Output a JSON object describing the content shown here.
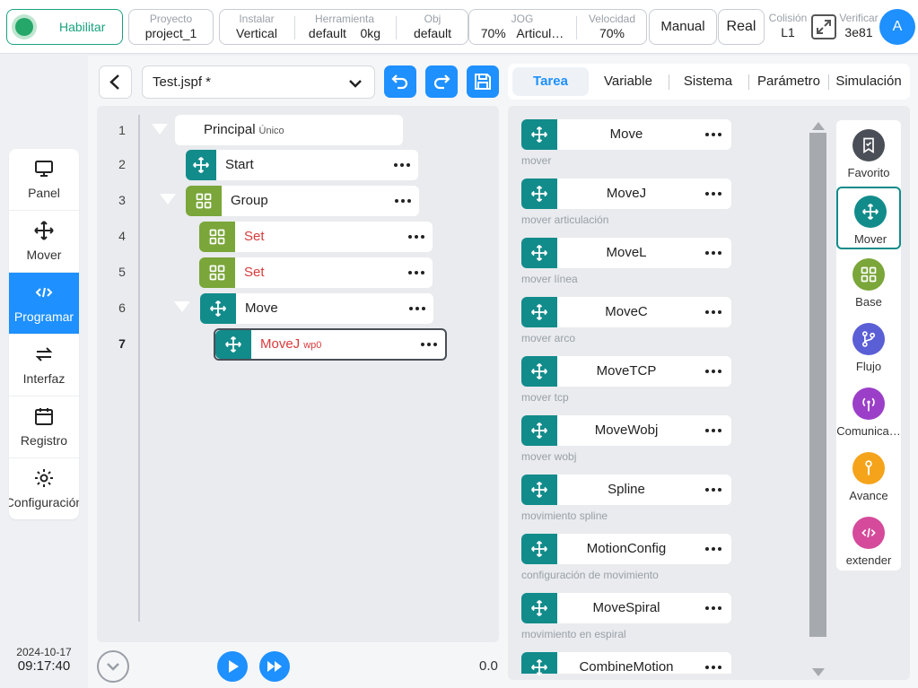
{
  "topbar": {
    "enable_label": "Habilitar",
    "project": {
      "label": "Proyecto",
      "value": "project_1"
    },
    "install": {
      "label": "Instalar",
      "value": "Vertical"
    },
    "tool": {
      "label": "Herramienta",
      "value": "default",
      "payload": "0kg"
    },
    "obj": {
      "label": "Obj",
      "value": "default"
    },
    "jog": {
      "label": "JOG",
      "percent": "70%",
      "mode": "Articul…"
    },
    "speed": {
      "label": "Velocidad",
      "value": "70%"
    },
    "manual_label": "Manual",
    "real_label": "Real",
    "collision": {
      "label": "Colisión",
      "value": "L1"
    },
    "verify": {
      "label": "Verificar",
      "value": "3e81"
    },
    "avatar_letter": "A",
    "enable_color": "#19a27f",
    "accent_color": "#1e90ff"
  },
  "leftnav": {
    "items": [
      {
        "label": "Panel",
        "icon": "monitor-icon"
      },
      {
        "label": "Mover",
        "icon": "move-arrows-icon"
      },
      {
        "label": "Programar",
        "icon": "code-icon",
        "active": true
      },
      {
        "label": "Interfaz",
        "icon": "swap-icon"
      },
      {
        "label": "Registro",
        "icon": "calendar-icon"
      },
      {
        "label": "Configuración",
        "icon": "gear-icon"
      }
    ],
    "date": "2024-10-17",
    "time": "09:17:40"
  },
  "editor": {
    "file_name": "Test.jspf *",
    "tree": [
      {
        "line": "1",
        "name": "Principal",
        "sub": "Único",
        "kind": "root"
      },
      {
        "line": "2",
        "name": "Start",
        "kind": "move",
        "color": "#128b8b"
      },
      {
        "line": "3",
        "name": "Group",
        "kind": "group",
        "color": "#7aa63a"
      },
      {
        "line": "4",
        "name": "Set",
        "kind": "group",
        "color": "#7aa63a",
        "red": true
      },
      {
        "line": "5",
        "name": "Set",
        "kind": "group",
        "color": "#7aa63a",
        "red": true
      },
      {
        "line": "6",
        "name": "Move",
        "kind": "move",
        "color": "#128b8b"
      },
      {
        "line": "7",
        "name": "MoveJ",
        "sub": "wp0",
        "kind": "move",
        "color": "#128b8b",
        "red": true,
        "selected": true
      }
    ],
    "speed_readout": "0.0"
  },
  "tabs": [
    {
      "label": "Tarea",
      "active": true
    },
    {
      "label": "Variable"
    },
    {
      "label": "Sistema"
    },
    {
      "label": "Parámetro"
    },
    {
      "label": "Simulación"
    }
  ],
  "commands": [
    {
      "name": "Move",
      "desc": "mover"
    },
    {
      "name": "MoveJ",
      "desc": "mover articulación"
    },
    {
      "name": "MoveL",
      "desc": "mover línea"
    },
    {
      "name": "MoveC",
      "desc": "mover arco"
    },
    {
      "name": "MoveTCP",
      "desc": "mover tcp"
    },
    {
      "name": "MoveWobj",
      "desc": "mover wobj"
    },
    {
      "name": "Spline",
      "desc": "movimiento spline"
    },
    {
      "name": "MotionConfig",
      "desc": "configuración de movimiento"
    },
    {
      "name": "MoveSpiral",
      "desc": "movimiento en espiral"
    },
    {
      "name": "CombineMotion",
      "desc": ""
    }
  ],
  "categories": [
    {
      "label": "Favorito",
      "icon": "bookmark-icon",
      "color": "#4a4f57"
    },
    {
      "label": "Mover",
      "icon": "move-arrows-icon",
      "color": "#128b8b",
      "active": true
    },
    {
      "label": "Base",
      "icon": "grid-icon",
      "color": "#7aa63a"
    },
    {
      "label": "Flujo",
      "icon": "branch-icon",
      "color": "#5b5fd6"
    },
    {
      "label": "Comunica…",
      "icon": "antenna-icon",
      "color": "#9b3fc8"
    },
    {
      "label": "Avance",
      "icon": "wrench-icon",
      "color": "#f5a31a"
    },
    {
      "label": "extender",
      "icon": "code-icon",
      "color": "#d54a9a"
    }
  ]
}
